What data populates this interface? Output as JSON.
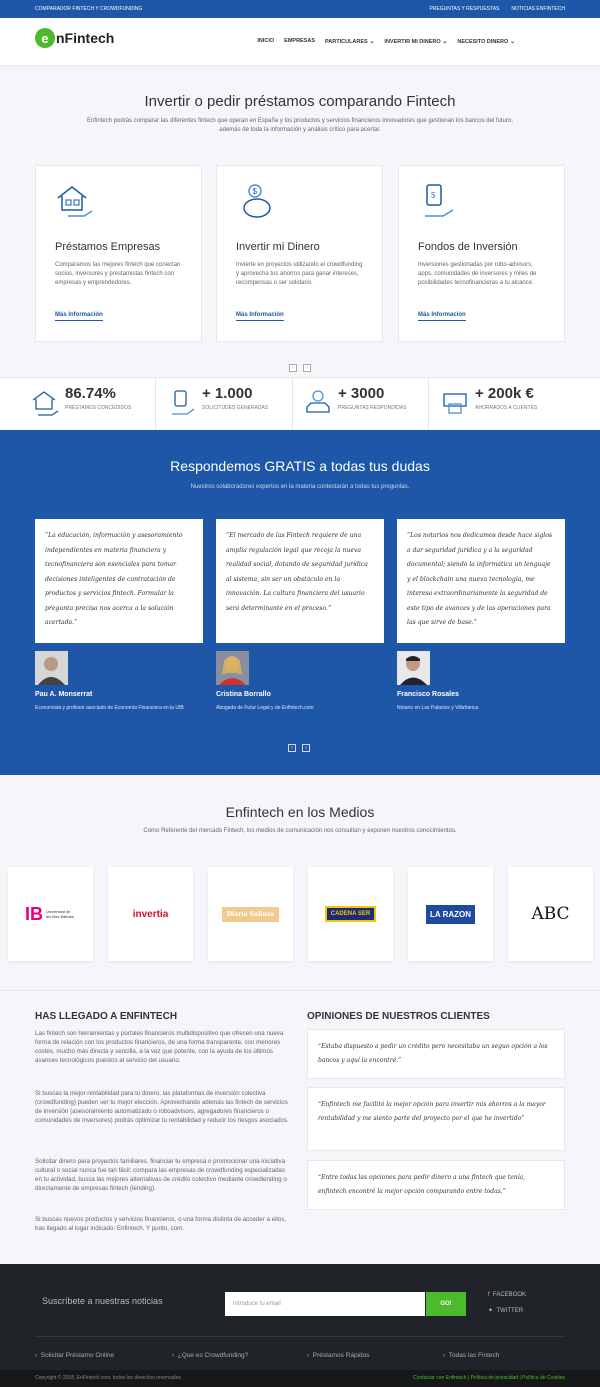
{
  "topbar": {
    "left": "COMPARADOR FINTECH Y CROWDFUNDING",
    "links": [
      "PREGUNTAS Y RESPUESTAS",
      "NOTICIAS ENFINTECH"
    ]
  },
  "logo": {
    "e": "e",
    "text": "nFintech"
  },
  "nav": [
    {
      "label": "INICIO"
    },
    {
      "label": "EMPRESAS"
    },
    {
      "label": "PARTICULARES"
    },
    {
      "label": "INVERTIR MI DINERO"
    },
    {
      "label": "NECESITO DINERO"
    }
  ],
  "hero": {
    "title": "Invertir o pedir préstamos comparando Fintech",
    "subtitle": "Enfintech podrás comparar las diferentes fintech que operan en España y los productos y servicios financieros innovadores que gestionan los bancos del futuro, además de toda la información y análisis crítico para acertar."
  },
  "cards": [
    {
      "title": "Préstamos Empresas",
      "desc": "Comparamos las mejores fintech que conectan socios, inversores y prestamistas fintech con empresas y emprendedores.",
      "more": "Más Información",
      "icon": "house-hand-icon"
    },
    {
      "title": "Invertir mi Dinero",
      "desc": "Invierte en proyectos utilizando el crowdfunding y aprovecha tus ahorros para ganar intereses, recompensas o ser solidario.",
      "more": "Más Información",
      "icon": "piggy-bank-icon"
    },
    {
      "title": "Fondos de Inversión",
      "desc": "Inversiones gestionadas por robo-advisors, apps, comunidades de inversores y miles de posibilidades tecnofinancieras a tu alcance.",
      "more": "Más Información",
      "icon": "money-hand-icon"
    }
  ],
  "pager": {
    "prev": "‹",
    "next": "›"
  },
  "stats": [
    {
      "num": "86.74%",
      "label": "PRÉSTAMOS CONCEDIDOS"
    },
    {
      "num": "+ 1.000",
      "label": "SOLICITUDES GENERADAS"
    },
    {
      "num": "+ 3000",
      "label": "PREGUNTAS RESPONDIDAS"
    },
    {
      "num": "+ 200k €",
      "label": "AHORRADOS A CLIENTES"
    }
  ],
  "dudas": {
    "title": "Respondemos GRATIS a todas tus dudas",
    "subtitle": "Nuestros colaboradores expertos en la materia contestarán a todas tus preguntas."
  },
  "quotes": [
    {
      "text": "“La educación, información y asesoramiento independientes en materia financiera y tecnofinanciera son esenciales para tomar decisiones inteligentes de contratación de productos y servicios fintech. Formular la pregunta precisa nos acerca a la solución acertada.”",
      "name": "Pau A. Monserrat",
      "role": "Economista y profesor asociado de Economía Financiera en la UIB"
    },
    {
      "text": "“El mercado de las Fintech requiere de una amplia regulación legal que recoja la nueva realidad social, dotando de seguridad jurídica al sistema, sin ser un obstáculo en la innovación. La cultura financiera del usuario será determinante en el proceso.”",
      "name": "Cristina Borrallo",
      "role": "Abogada de Futur Legal y de Enfintech.com"
    },
    {
      "text": "“Los notarios nos dedicamos desde hace siglos a dar seguridad jurídica y a la seguridad documental; siendo la informática un lenguaje y el blockchain una nueva tecnología, me interesa extraordinariamente la seguridad de este tipo de avances y de las operaciones para las que sirve de base.”",
      "name": "Francisco Rosales",
      "role": "Notario en Las Palacios y Villafranca"
    }
  ],
  "medios": {
    "title": "Enfintech en los Medios",
    "subtitle": "Como Referente del mercado Fintech, los medios de comunicación nos consultan y exponen nuestros conocimientos.",
    "logos": [
      {
        "name": "Universitat de les Illes Balears",
        "short": "IB"
      },
      {
        "name": "invertia"
      },
      {
        "name": "Diario Salinas"
      },
      {
        "name": "CADENA SER"
      },
      {
        "name": "LA RAZON"
      },
      {
        "name": "ABC"
      }
    ]
  },
  "about": {
    "title": "HAS LLEGADO A ENFINTECH",
    "paras": [
      "Las fintech son herramientas y portales financieros multidispositivo que ofrecen una nueva forma de relación con los productos financieros, de una forma transparente, con menores costes, mucho más directa y sencilla, a la vez que potente, con la ayuda de los últimos avances tecnológicos puestos al servicio del usuario.",
      "Si buscas la mejor rentabilidad para tu dinero, las plataformas de inversión colectiva (crowdfunding) pueden ser tu mejor elección. Aprovechando además las fintech de servicios de inversión (asesoramiento automatizado o roboadvisors, agregadores financieros o comunidades de inversores) podrás optimizar tu rentabilidad y reducir los riesgos asociados.",
      "Solicitar dinero para proyectos familiares, financiar tu empresa o promocionar una iniciativa cultural o social nunca fue tan fácil: compara las empresas de crowdfunding especializadas en tu actividad, busca las mejores alternativas de crédito colectivo mediante crowdlending o directamente de empresas fintech (lending).",
      "Si buscas nuevos productos y servicios financieros, o una forma distinta de acceder a ellos, has llegado al lugar indicado: Enfintech. Y punto, com."
    ]
  },
  "opinions": {
    "title": "OPINIONES DE NUESTROS CLIENTES",
    "items": [
      "“Estaba dispuesto a pedir un crédito pero necesitaba un seguo opción a los bancos y aquí la encontré.”",
      "“Enfintech me facilitó la mejor opción para invertir mis ahorros a la mayor rentabilidad y me siento parte del proyecto por el que he invertido”",
      "“Entre todas las opciones para pedir dinero a una fintech que tenía, enfintech encontré la mejor opción comparando entre todas.”"
    ]
  },
  "footer": {
    "subscribe": "Suscríbete a nuestras noticias",
    "placeholder": "Introduce tu email",
    "button": "GO!",
    "social": [
      "FACEBOOK",
      "TWITTER"
    ],
    "links": [
      "Solicitar Préstamo Online",
      "¿Que es Crowdfunding?",
      "Préstamos Rápidos",
      "Todas las Fintech"
    ],
    "copyright": "Copyright © 2018, EnFintech.com, todos los derechos reservados",
    "legal": "Contactar con Enfintech | Política de privacidad | Política de Cookies"
  },
  "colors": {
    "brand": "#1e57a8",
    "accent": "#4cba2c"
  }
}
